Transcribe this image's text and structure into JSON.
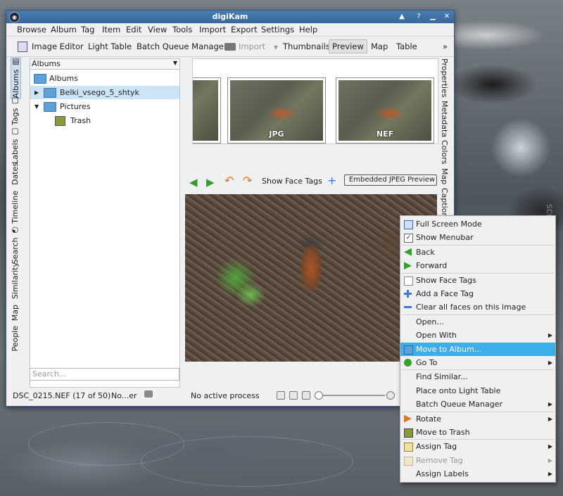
{
  "window": {
    "title": "digiKam"
  },
  "menu": [
    "Browse",
    "Album",
    "Tag",
    "Item",
    "Edit",
    "View",
    "Tools",
    "Import",
    "Export",
    "Settings",
    "Help"
  ],
  "toolbar": {
    "image_editor": "Image Editor",
    "light_table": "Light Table",
    "batch_queue": "Batch Queue Manager",
    "import": "Import",
    "thumbnails": "Thumbnails",
    "preview": "Preview",
    "map": "Map",
    "table": "Table",
    "overflow": "»"
  },
  "left_tabs": [
    "Albums",
    "Tags",
    "Labels",
    "Dates",
    "Timeline",
    "Search",
    "Similarity",
    "Map",
    "People"
  ],
  "album_panel": {
    "combo": "Albums",
    "root": "Albums",
    "items": [
      "Belki_vsego_5_shtyk",
      "Pictures",
      "Trash"
    ],
    "search_placeholder": "Search..."
  },
  "thumbs": [
    "JPG",
    "NEF"
  ],
  "right_tabs": [
    "Properties",
    "Metadata",
    "Colors",
    "Map",
    "Caption"
  ],
  "preview_bar": {
    "show_face_tags": "Show Face Tags",
    "embedded": "Embedded JPEG Preview"
  },
  "status": {
    "file": "DSC_0215.NEF (17 of 50)",
    "filter": "No...er",
    "process": "No active process"
  },
  "context_menu": [
    {
      "label": "Full Screen Mode",
      "icon": "fullscreen-icon"
    },
    {
      "label": "Show Menubar",
      "icon": "checkbox-checked-icon"
    },
    {
      "sep": true
    },
    {
      "label": "Back",
      "icon": "arrow-left-icon"
    },
    {
      "label": "Forward",
      "icon": "arrow-right-icon"
    },
    {
      "sep": true
    },
    {
      "label": "Show Face Tags",
      "icon": "checkbox-empty-icon"
    },
    {
      "label": "Add a Face Tag",
      "icon": "plus-icon"
    },
    {
      "label": "Clear all faces on this image",
      "icon": "minus-icon"
    },
    {
      "sep": true
    },
    {
      "label": "Open...",
      "icon": "none"
    },
    {
      "label": "Open With",
      "icon": "none",
      "submenu": true
    },
    {
      "label": "Move to Album...",
      "icon": "move-icon",
      "highlight": true
    },
    {
      "label": "Go To",
      "icon": "goto-icon",
      "submenu": true
    },
    {
      "sep": true
    },
    {
      "label": "Find Similar...",
      "icon": "none"
    },
    {
      "label": "Place onto Light Table",
      "icon": "none"
    },
    {
      "label": "Batch Queue Manager",
      "icon": "none",
      "submenu": true
    },
    {
      "sep": true
    },
    {
      "label": "Rotate",
      "icon": "rotate-icon",
      "submenu": true
    },
    {
      "label": "Move to Trash",
      "icon": "trash-icon"
    },
    {
      "sep": true
    },
    {
      "label": "Assign Tag",
      "icon": "tag-icon",
      "submenu": true
    },
    {
      "label": "Remove Tag",
      "icon": "tag-icon",
      "submenu": true,
      "disabled": true
    },
    {
      "label": "Assign Labels",
      "icon": "none",
      "submenu": true
    }
  ],
  "watermark": "screenshots.ru"
}
